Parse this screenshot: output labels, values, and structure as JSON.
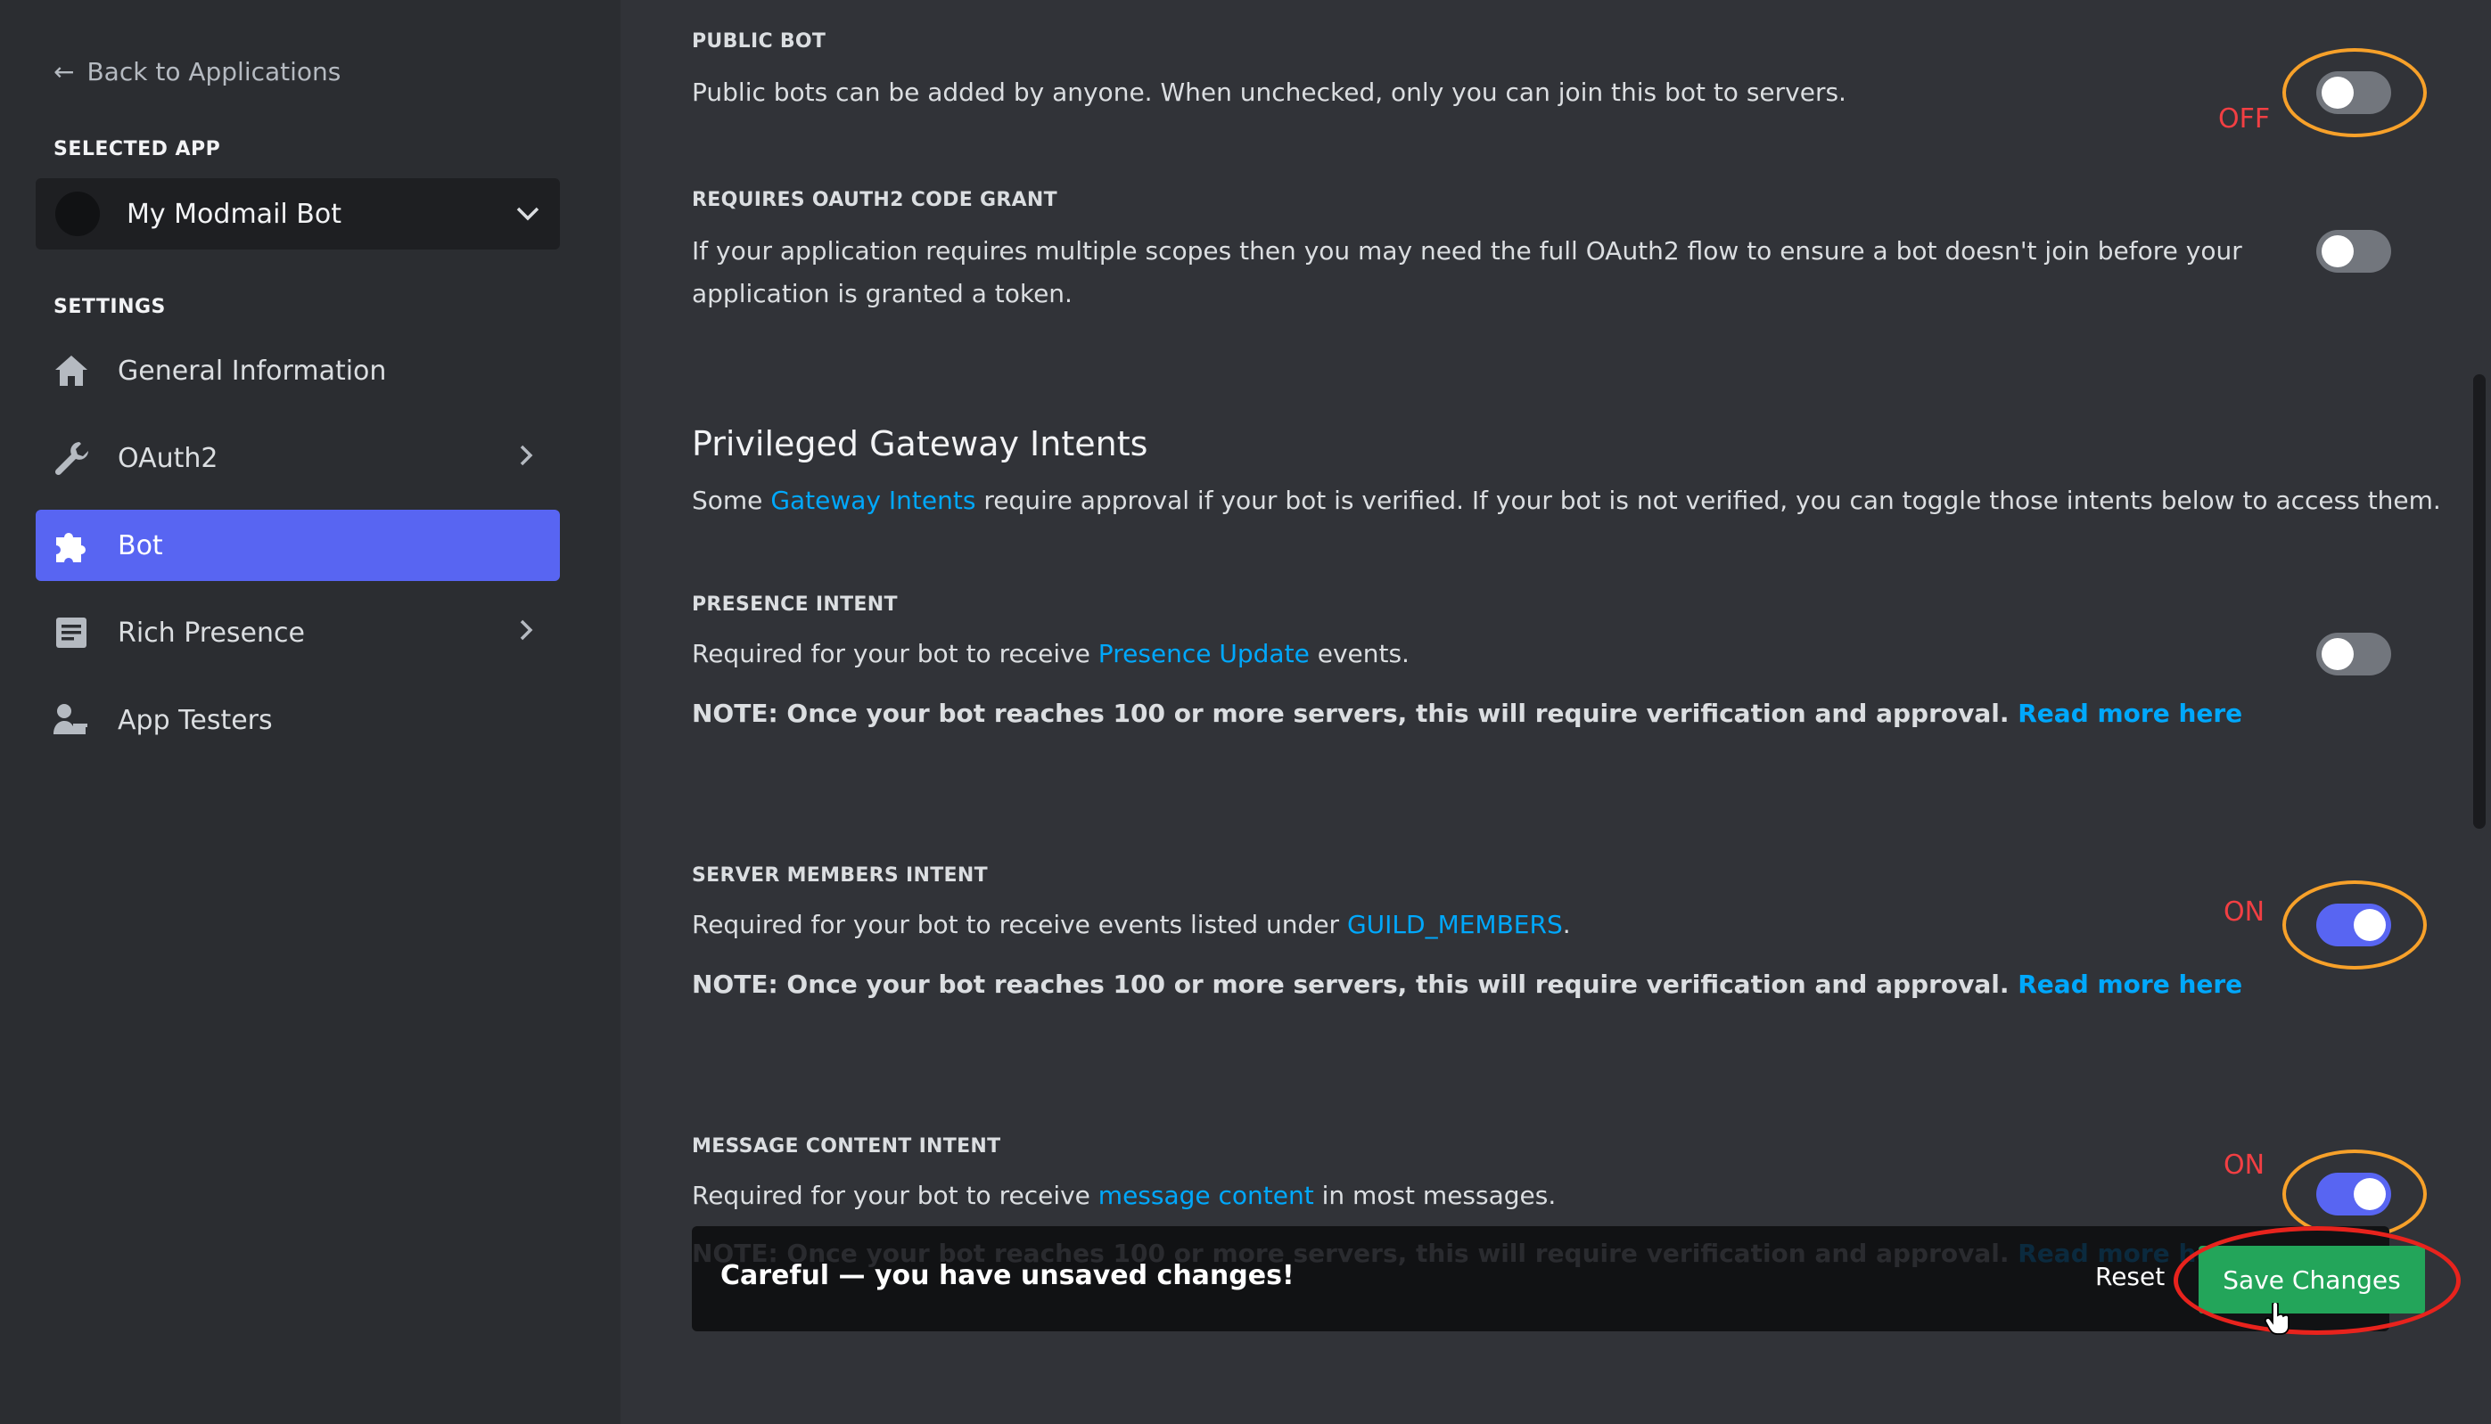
{
  "sidebar": {
    "back_label": "Back to Applications",
    "selected_app_label": "SELECTED APP",
    "app_name": "My Modmail Bot",
    "settings_label": "SETTINGS",
    "items": [
      {
        "label": "General Information",
        "icon": "home-icon"
      },
      {
        "label": "OAuth2",
        "icon": "wrench-icon",
        "has_chevron": true
      },
      {
        "label": "Bot",
        "icon": "puzzle-icon",
        "active": true
      },
      {
        "label": "Rich Presence",
        "icon": "document-icon",
        "has_chevron": true
      },
      {
        "label": "App Testers",
        "icon": "person-icon"
      }
    ]
  },
  "settings": {
    "public_bot": {
      "label": "PUBLIC BOT",
      "desc": "Public bots can be added by anyone. When unchecked, only you can join this bot to servers.",
      "enabled": false,
      "annotation": "OFF"
    },
    "oauth2_grant": {
      "label": "REQUIRES OAUTH2 CODE GRANT",
      "desc_line1": "If your application requires multiple scopes then you may need the full OAuth2 flow to ensure a bot doesn't join before your",
      "desc_line2": "application is granted a token.",
      "enabled": false
    },
    "intents_heading": "Privileged Gateway Intents",
    "intents_desc": {
      "pre": "Some ",
      "link": "Gateway Intents",
      "post": " require approval if your bot is verified. If your bot is not verified, you can toggle those intents below to access them."
    },
    "presence": {
      "label": "PRESENCE INTENT",
      "pre": "Required for your bot to receive ",
      "link": "Presence Update",
      "post": " events.",
      "note": "NOTE: Once your bot reaches 100 or more servers, this will require verification and approval.",
      "note_link": "Read more here",
      "enabled": false
    },
    "members": {
      "label": "SERVER MEMBERS INTENT",
      "pre": "Required for your bot to receive events listed under ",
      "link": "GUILD_MEMBERS",
      "post": ".",
      "note": "NOTE: Once your bot reaches 100 or more servers, this will require verification and approval.",
      "note_link": "Read more here",
      "enabled": true,
      "annotation": "ON"
    },
    "message_content": {
      "label": "MESSAGE CONTENT INTENT",
      "pre": "Required for your bot to receive ",
      "link": "message content",
      "post": " in most messages.",
      "note": "NOTE: Once your bot reaches 100 or more servers, this will require verification and approval.",
      "note_link": "Read more here",
      "enabled": true,
      "annotation": "ON"
    }
  },
  "save_bar": {
    "message": "Careful — you have unsaved changes!",
    "reset_label": "Reset",
    "save_label": "Save Changes"
  },
  "colors": {
    "accent": "#5865f2",
    "link": "#00a8fc",
    "save_green": "#23a55a",
    "annotation_orange": "#f7a12a",
    "annotation_red": "#e8231d"
  }
}
